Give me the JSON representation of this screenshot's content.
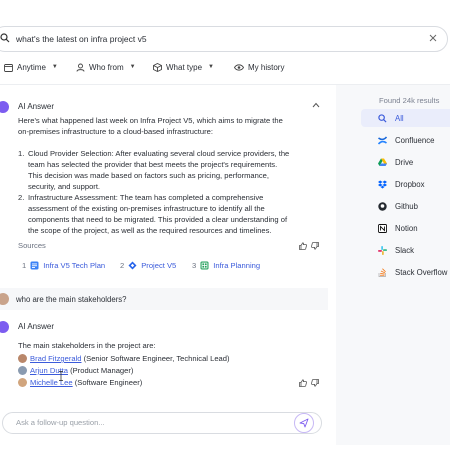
{
  "search": {
    "query": "what's the latest on infra project v5"
  },
  "filters": [
    {
      "label": "Anytime"
    },
    {
      "label": "Who from"
    },
    {
      "label": "What type"
    },
    {
      "label": "My history"
    }
  ],
  "answer1": {
    "label": "AI Answer",
    "intro": [
      "Here's what happened last week on Infra Project V5, which aims to migrate the",
      "on-premises infrastructure to a cloud-based infrastructure:"
    ],
    "items": [
      {
        "num": "1.",
        "lines": [
          "Cloud Provider Selection: After evaluating several cloud service providers, the",
          "team has selected the provider that best meets the project's requirements.",
          "This decision was made based on factors such as pricing, performance,",
          "security, and support."
        ]
      },
      {
        "num": "2.",
        "lines": [
          "Infrastructure Assessment: The team has completed a comprehensive",
          "assessment of the existing on-premises infrastructure to identify all the",
          "components that need to be migrated. This provided a clear understanding of",
          "the scope of the project, as well as the required resources and timelines."
        ]
      }
    ],
    "sources_label": "Sources",
    "sources": [
      {
        "num": "1",
        "label": "Infra V5 Tech Plan",
        "color": "#3b82f6"
      },
      {
        "num": "2",
        "label": "Project V5",
        "color": "#2563eb"
      },
      {
        "num": "3",
        "label": "Infra Planning",
        "color": "#22a05b"
      }
    ]
  },
  "user_question": "who are the main stakeholders?",
  "answer2": {
    "label": "AI Answer",
    "intro": "The main stakeholders in the project are:",
    "people": [
      {
        "name": "Brad Fitzgerald",
        "role": " (Senior Software Engineer, Technical Lead)",
        "color": "#b9876a"
      },
      {
        "name": "Arjun Dutta",
        "role": " (Product Manager)",
        "color": "#8a9bb0"
      },
      {
        "name": "Michelle Lee",
        "role": " (Software Engineer)",
        "color": "#d1a57d"
      }
    ]
  },
  "followup": {
    "placeholder": "Ask a follow-up question..."
  },
  "sidebar": {
    "results": "Found 24k results",
    "items": [
      {
        "label": "All",
        "icon": "search-icon",
        "color": "#3b5bdb"
      },
      {
        "label": "Confluence",
        "icon": "confluence-icon",
        "color": "#1868db"
      },
      {
        "label": "Drive",
        "icon": "drive-icon",
        "color": "#0f9d58"
      },
      {
        "label": "Dropbox",
        "icon": "dropbox-icon",
        "color": "#0061fe"
      },
      {
        "label": "Github",
        "icon": "github-icon",
        "color": "#24292f"
      },
      {
        "label": "Notion",
        "icon": "notion-icon",
        "color": "#111111"
      },
      {
        "label": "Slack",
        "icon": "slack-icon",
        "color": "#e01e5a"
      },
      {
        "label": "Stack Overflow",
        "icon": "stackoverflow-icon",
        "color": "#f48024"
      }
    ]
  },
  "colors": {
    "accent": "#3b5bdb",
    "ai": "#7c5cf0"
  }
}
